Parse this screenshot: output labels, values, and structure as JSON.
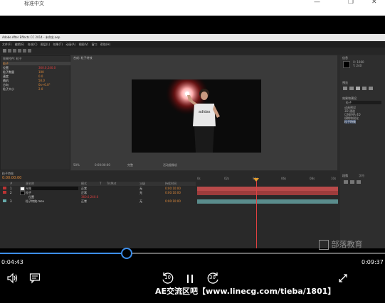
{
  "top_bar": {
    "title": "标准中文",
    "minimize_icon": "—",
    "restore_icon": "❐",
    "close_icon": "✕"
  },
  "ae": {
    "window_title": "Adobe After Effects CC 2014 - 未命名.aep",
    "menu": [
      "文件(F)",
      "编辑(E)",
      "合成(C)",
      "图层(L)",
      "效果(T)",
      "动画(A)",
      "视图(V)",
      "窗口",
      "帮助(H)"
    ],
    "left_panel": {
      "header": "效果控件: 粒子",
      "rows": [
        {
          "label": "粒子",
          "value": "",
          "color": "#e08a3a"
        },
        {
          "label": "位置",
          "value": "360.0,240.0",
          "color": "#e04040"
        },
        {
          "label": "粒子数量",
          "value": "100",
          "color": "#e08a3a"
        },
        {
          "label": "速度",
          "value": "0.0",
          "color": "#e08a3a"
        },
        {
          "label": "随机",
          "value": "50.0",
          "color": "#e08a3a"
        },
        {
          "label": "方向",
          "value": "0x+0.0°",
          "color": "#e08a3a"
        },
        {
          "label": "粒子大小",
          "value": "2.0",
          "color": "#e08a3a"
        }
      ]
    },
    "viewer_tab": "合成: 粒子特效",
    "viewer_bottom": {
      "zoom": "50%",
      "timecode": "0:00:00:00",
      "resolution": "完整",
      "view": "活动摄像机"
    },
    "right_panel": {
      "info_tab": "信息",
      "coords": "X: 1060\nY: 240",
      "preview_tab": "预览",
      "effects_tab": "效果和预设",
      "effects_items": [
        "动画预设",
        "3D 通道",
        "CINEMA 4D",
        "模糊和锐化",
        "粒子特效"
      ],
      "search_label": "粒子"
    },
    "timeline": {
      "tab": "粒子特效",
      "timecode": "0:00:00:00",
      "headers": [
        "#",
        "源名称",
        "模式",
        "T",
        "TrkMat",
        "父级",
        "持续时间"
      ],
      "layers": [
        {
          "num": "1",
          "name": "光效",
          "mode": "正常",
          "parent": "无",
          "duration": "0:00:10:00"
        },
        {
          "num": "2",
          "name": "粒子",
          "mode": "正常",
          "parent": "无",
          "duration": "0:00:10:00"
        },
        {
          "num": "",
          "name": "位置",
          "mode": "",
          "parent": "",
          "duration": "360.0,240.0"
        },
        {
          "num": "3",
          "name": "粒子特效.mov",
          "mode": "正常",
          "parent": "无",
          "duration": "0:00:10:00"
        }
      ],
      "ruler": [
        "0s",
        "02s",
        "04s",
        "06s",
        "08s",
        "10s"
      ]
    },
    "tl_right_tabs": [
      "段落",
      "字符"
    ]
  },
  "player": {
    "current_time": "0:04:43",
    "total_time": "0:09:37",
    "progress_fraction": 0.329,
    "rewind_label": "10",
    "forward_label": "30",
    "watermark": "部落教育",
    "caption": "AE交流区吧【www.linecg.com/tieba/1801】"
  }
}
